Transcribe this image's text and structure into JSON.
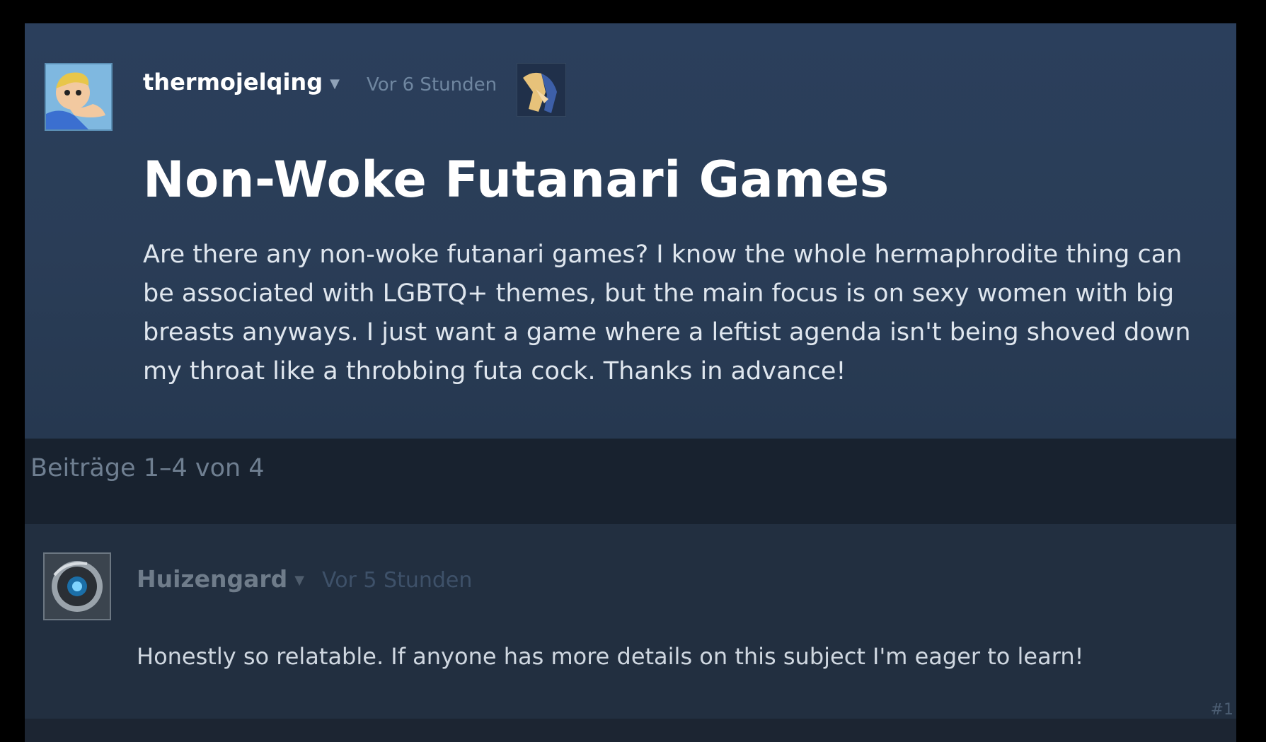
{
  "original_post": {
    "author": "thermojelqing",
    "timestamp": "Vor 6 Stunden",
    "title": "Non-Woke Futanari Games",
    "body_lines": [
      "Are there any non-woke futanari games? I know the whole hermaphrodite thing can",
      "be associated with LGBTQ+ themes, but the main focus is on sexy women with big",
      "breasts anyways. I just want a game where a leftist agenda isn't being shoved down",
      "my throat like a throbbing futa cock. Thanks in advance!"
    ]
  },
  "pagination": {
    "label": "Beiträge 1–4 von 4"
  },
  "replies": [
    {
      "author": "Huizengard",
      "timestamp": "Vor 5 Stunden",
      "text": "Honestly so relatable. If anyone has more details on this subject I'm eager to learn!",
      "post_number": "#1"
    }
  ]
}
